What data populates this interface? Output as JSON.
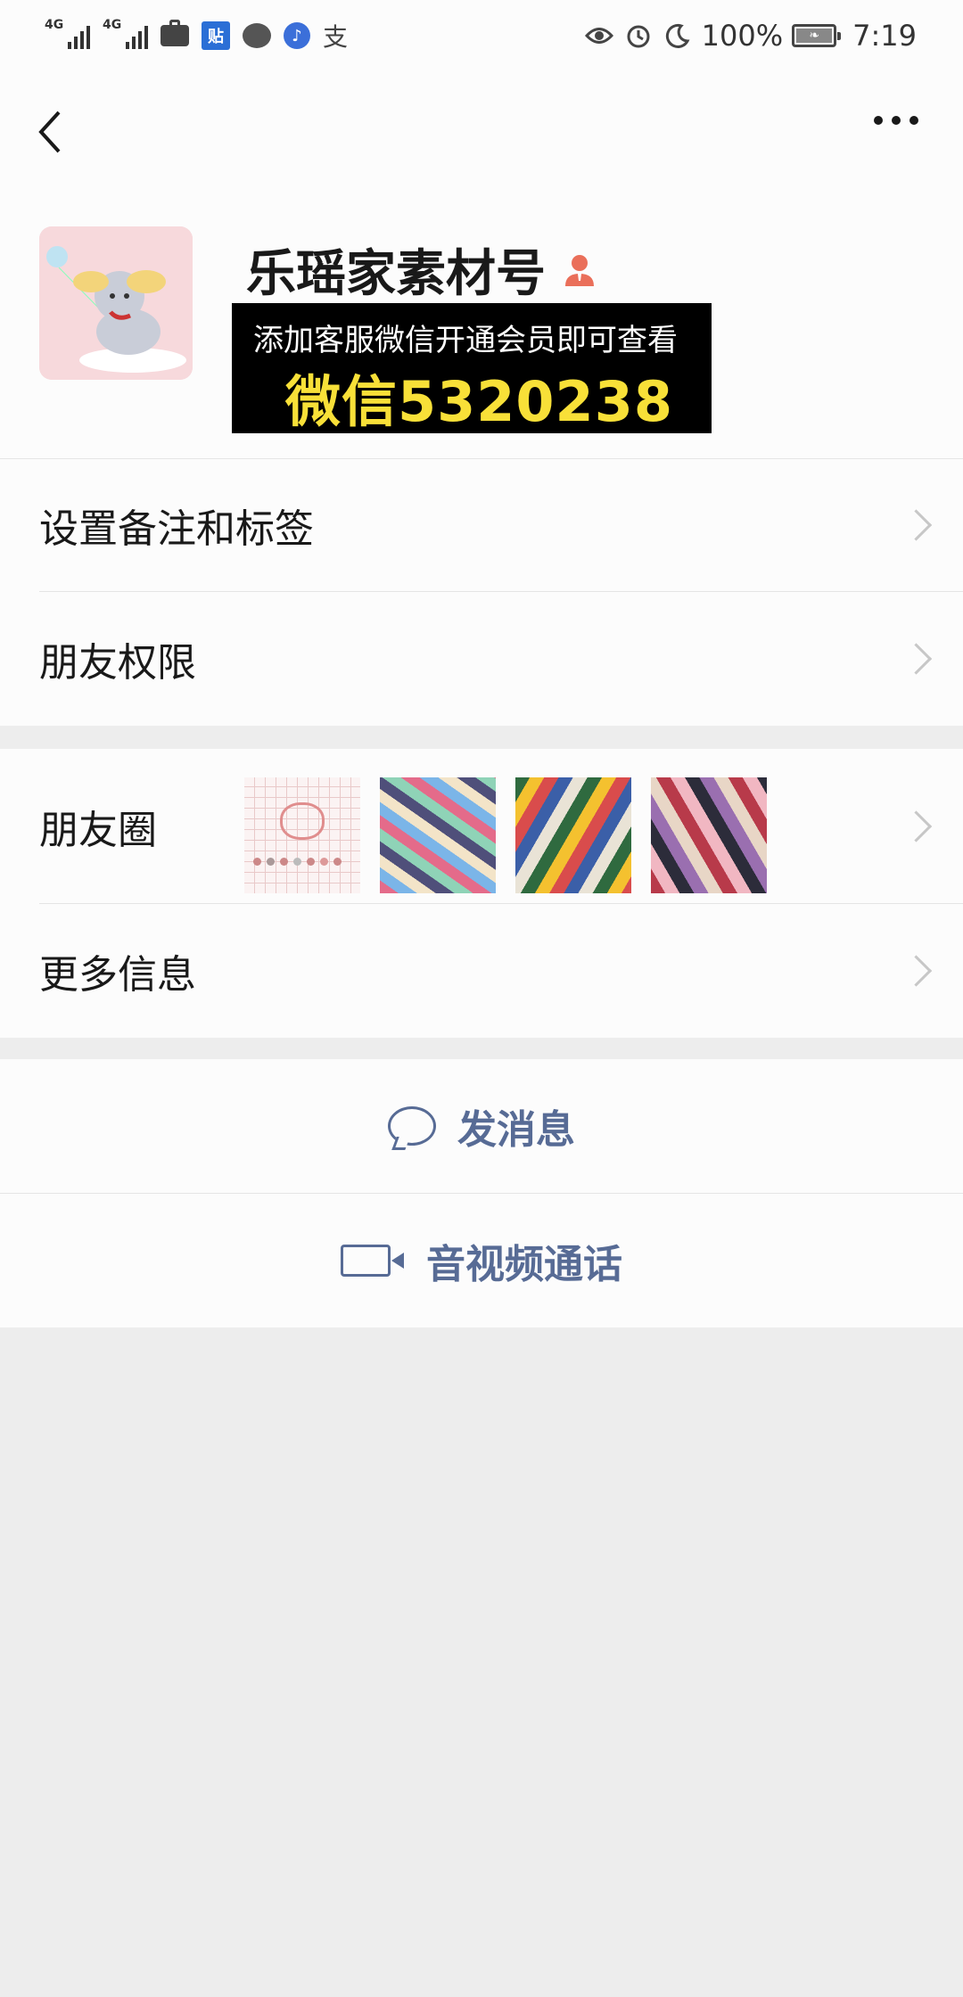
{
  "status_bar": {
    "net1": "4G",
    "net2": "4G",
    "tieba_icon_text": "贴",
    "alipay_icon_text": "支",
    "battery": "100%",
    "time": "7:19"
  },
  "nav": {
    "back_icon": "chevron-left-icon",
    "more_icon": "more-dots-icon"
  },
  "profile": {
    "name": "乐瑶家素材号",
    "badge_icon": "person-badge-icon",
    "promo_line1": "添加客服微信开通会员即可查看",
    "promo_line2": "微信5320238"
  },
  "list": {
    "remarks_label": "设置备注和标签",
    "permissions_label": "朋友权限",
    "moments_label": "朋友圈",
    "more_info_label": "更多信息"
  },
  "actions": {
    "message_label": "发消息",
    "call_label": "音视频通话"
  },
  "colors": {
    "link_blue": "#576b95",
    "background": "#ededed",
    "surface": "#fcfcfc",
    "promo_yellow": "#f8e038"
  }
}
